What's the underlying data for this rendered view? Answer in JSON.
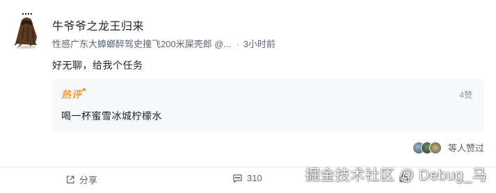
{
  "post": {
    "author": "牛爷爷之龙王归来",
    "author_title": "性感广东大蟑螂醉驾史撞飞200米屎壳郎 @...",
    "time": "3小时前",
    "content": "好无聊，给我个任务"
  },
  "hot_comment": {
    "badge": "热评",
    "likes": "4赞",
    "text": "喝一杯蜜雪冰城柠檬水"
  },
  "likers": {
    "text": "等人赞过"
  },
  "actions": {
    "share_label": "分享",
    "comment_count": "310"
  },
  "watermark": "掘金技术社区 @ Debug_马",
  "colors": {
    "badge": "#f29b38",
    "meta_text": "#5a6470",
    "hot_bg": "#f7f8fa"
  }
}
